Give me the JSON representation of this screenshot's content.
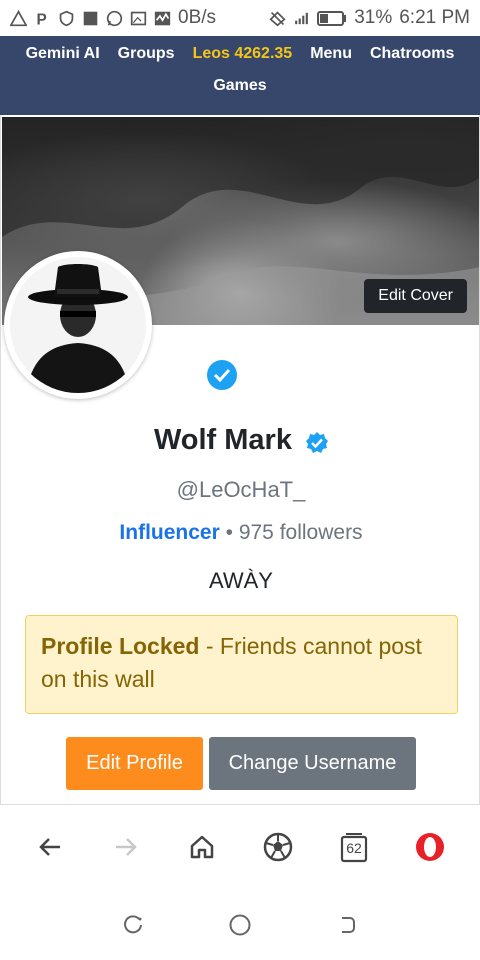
{
  "status_bar": {
    "data_speed": "0B/s",
    "battery_percent": "31%",
    "time": "6:21 PM",
    "icons": [
      "alert-triangle-icon",
      "p-icon",
      "shield-icon",
      "square-icon",
      "whatsapp-icon",
      "gallery-icon",
      "activity-icon",
      "wifi-off-icon",
      "signal-icon",
      "battery-icon"
    ]
  },
  "nav": {
    "links": [
      "Gemini AI",
      "Groups",
      "Leos 4262.35",
      "Menu",
      "Chatrooms"
    ],
    "games": "Games",
    "accent_color": "#f5c518"
  },
  "profile": {
    "edit_cover_label": "Edit Cover",
    "display_name": "Wolf Mark",
    "username": "@LeOcHaT_",
    "role": "Influencer",
    "followers": "975 followers",
    "separator": "•",
    "status": "AWÀY",
    "alert_title": "Profile Locked",
    "alert_message": "- Friends cannot post on this wall",
    "edit_profile_label": "Edit Profile",
    "change_username_label": "Change Username"
  },
  "browser_toolbar": {
    "tabs_count": "62",
    "icons": [
      "back-arrow-icon",
      "forward-arrow-icon",
      "home-icon",
      "soccer-ball-icon",
      "tabs-icon",
      "opera-icon"
    ]
  },
  "system_nav": {
    "icons": [
      "recent-apps-icon",
      "home-circle-icon",
      "back-icon"
    ]
  },
  "colors": {
    "nav_bg": "#37476b",
    "role_blue": "#1a73e8",
    "alert_bg": "#fff3cd",
    "alert_text": "#856404",
    "edit_profile_orange": "#fd8c1c",
    "change_username_gray": "#6c757d",
    "verified_blue": "#1da1f2",
    "opera_red": "#e8202a"
  }
}
